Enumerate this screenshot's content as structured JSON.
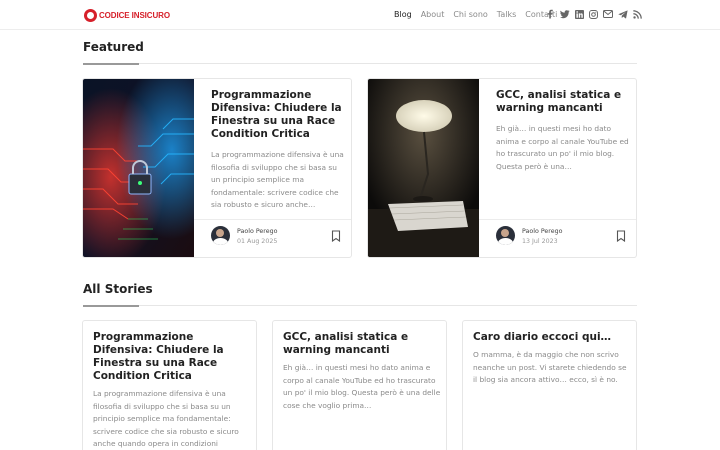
{
  "header": {
    "logo_line1": "CODICE",
    "logo_line2": "INSICURO",
    "nav": [
      "Blog",
      "About",
      "Chi sono",
      "Talks",
      "Contatti"
    ],
    "active_nav": "Blog",
    "social_icons": [
      "facebook-icon",
      "twitter-icon",
      "linkedin-icon",
      "instagram-icon",
      "email-icon",
      "telegram-icon",
      "rss-icon"
    ]
  },
  "featured": {
    "title": "Featured",
    "cards": [
      {
        "title": "Programmazione Difensiva: Chiudere la Finestra su una Race Condition Critica",
        "excerpt": "La programmazione difensiva è una filosofia di sviluppo che si basa su un principio semplice ma fondamentale: scrivere codice che sia robusto e sicuro anche…",
        "author": "Paolo Perego",
        "date": "01 Aug 2025"
      },
      {
        "title": "GCC, analisi statica e warning mancanti",
        "excerpt": "Eh già… in questi mesi ho dato anima e corpo al canale YouTube ed ho trascurato un po' il mio blog. Questa però è una…",
        "author": "Paolo Perego",
        "date": "13 Jul 2023"
      }
    ]
  },
  "all_stories": {
    "title": "All Stories",
    "cards": [
      {
        "title": "Programmazione Difensiva: Chiudere la Finestra su una Race Condition Critica",
        "excerpt": "La programmazione difensiva è una filosofia di sviluppo che si basa su un principio semplice ma fondamentale: scrivere codice che sia robusto e sicuro anche quando opera in condizioni"
      },
      {
        "title": "GCC, analisi statica e warning mancanti",
        "excerpt": "Eh già… in questi mesi ho dato anima e corpo al canale YouTube ed ho trascurato un po' il mio blog. Questa però è una delle cose che voglio prima…"
      },
      {
        "title": "Caro diario eccoci qui…",
        "excerpt": "O mamma, è da maggio che non scrivo neanche un post. Vi starete chiedendo se il blog sia ancora attivo… ecco, sì è no."
      }
    ]
  },
  "colors": {
    "brand_red": "#d6202a",
    "text_dark": "#222222",
    "text_muted": "#8a8a8a",
    "border": "#e6e6e6"
  }
}
